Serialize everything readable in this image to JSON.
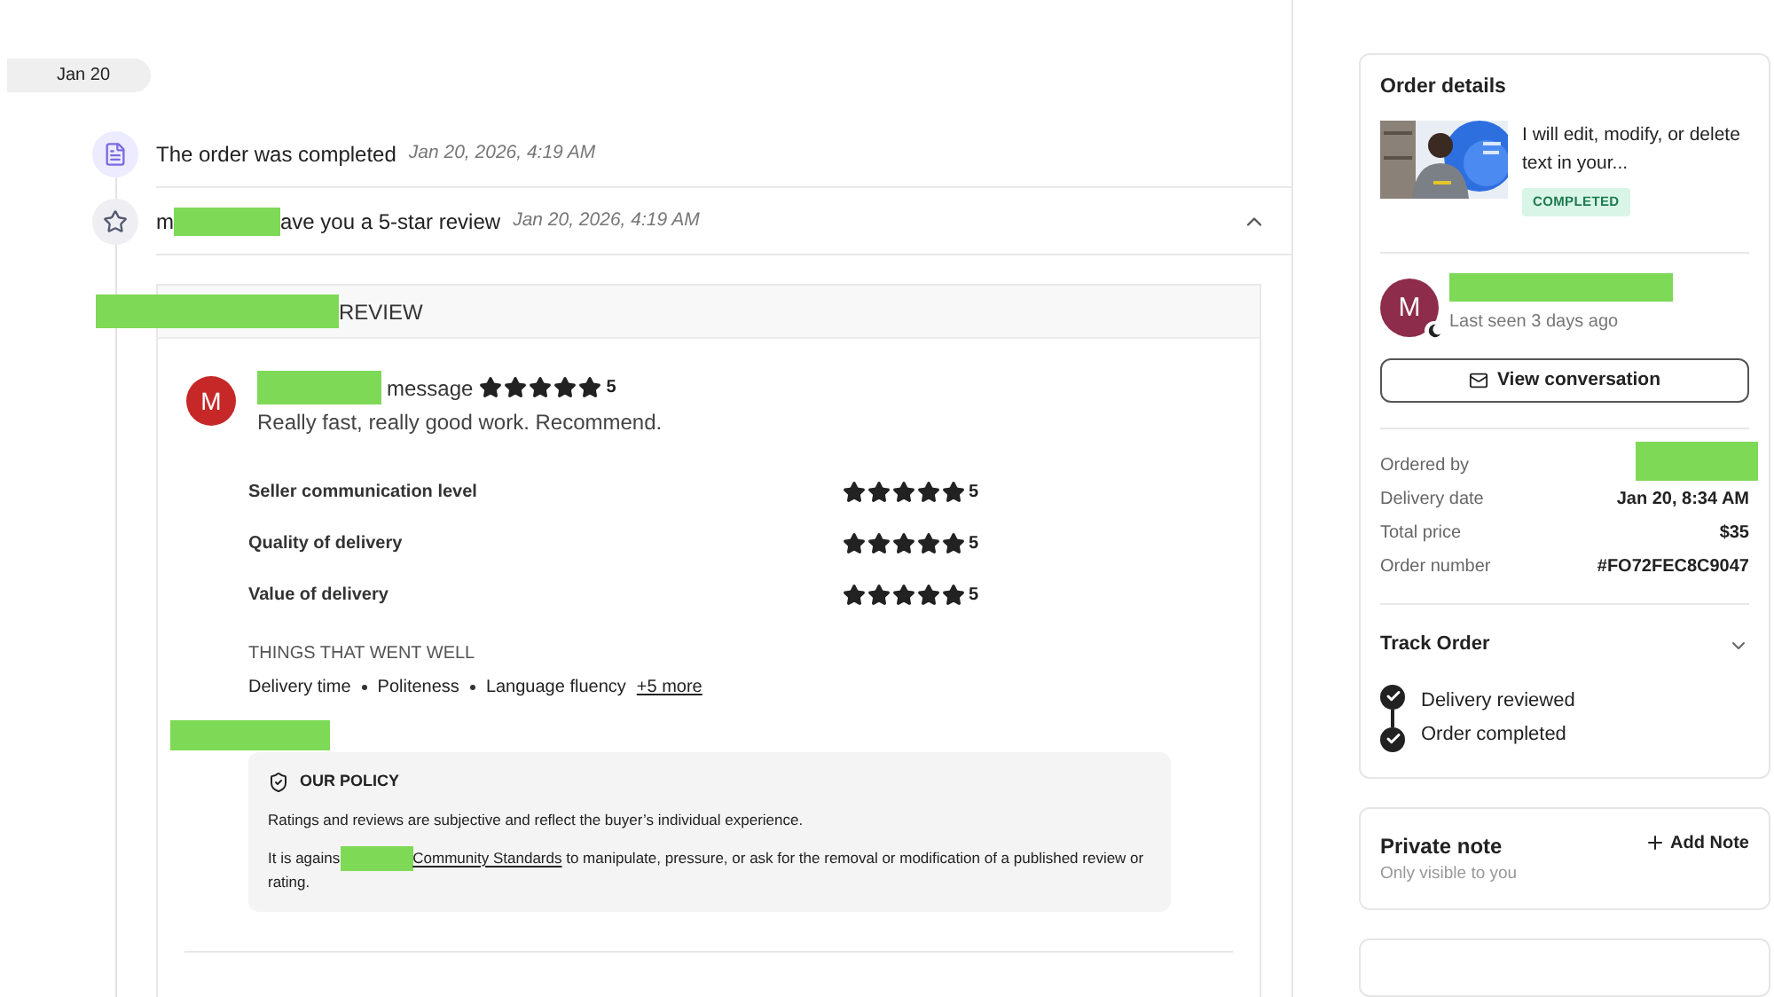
{
  "date_pill": "Jan 20",
  "events": [
    {
      "kind": "document",
      "before": "The order was completed",
      "redacted": false,
      "time": "Jan 20, 2026, 4:19 AM"
    },
    {
      "kind": "star",
      "before": "m",
      "redacted": true,
      "after": "ave you a 5-star review",
      "time": "Jan 20, 2026, 4:19 AM",
      "expanded": true
    }
  ],
  "review": {
    "header": {
      "redacted": true,
      "text": "REVIEW"
    },
    "reviewer": {
      "initial": "M",
      "redacted": true,
      "text": "message",
      "stars": 5,
      "score": "5"
    },
    "comment": "Really fast, really good work. Recommend.",
    "ratings": [
      {
        "label": "Seller communication level",
        "stars": 5,
        "score": "5"
      },
      {
        "label": "Quality of delivery",
        "stars": 5,
        "score": "5"
      },
      {
        "label": "Value of delivery",
        "stars": 5,
        "score": "5"
      }
    ],
    "went_well": {
      "title": "THINGS THAT WENT WELL",
      "items": [
        "Delivery time",
        "Politeness",
        "Language fluency"
      ],
      "more": "+5 more"
    },
    "redacted_line": true,
    "policy": {
      "title": "OUR POLICY",
      "text": "Ratings and reviews are subjective and reflect the buyer’s individual experience.",
      "before": "It is agains",
      "redacted": true,
      "link": "Community Standards",
      "after": " to manipulate, pressure, or ask for the removal or modification of a published review or rating."
    }
  },
  "order_details": {
    "title": "Order details",
    "gig": {
      "kind": "picture",
      "description": "I will edit, modify, or delete text in your...",
      "status": "COMPLETED"
    },
    "seller": {
      "initial": "M",
      "name_redacted": true,
      "last_seen": "Last seen 3 days ago",
      "away": true
    },
    "button": "View conversation",
    "details": [
      {
        "label": "Ordered by",
        "redacted": true
      },
      {
        "label": "Delivery date",
        "redacted": false,
        "value": "Jan 20, 8:34 AM"
      },
      {
        "label": "Total price",
        "redacted": false,
        "value": "$35"
      },
      {
        "label": "Order number",
        "redacted": false,
        "value": "#FO72FEC8C9047"
      }
    ],
    "track": {
      "title": "Track Order",
      "expanded": false,
      "steps": [
        {
          "label": "Delivery reviewed",
          "done": true
        },
        {
          "label": "Order completed",
          "done": true
        }
      ]
    }
  },
  "private_note": {
    "title": "Private note",
    "subtitle": "Only visible to you",
    "action": "Add Note"
  }
}
